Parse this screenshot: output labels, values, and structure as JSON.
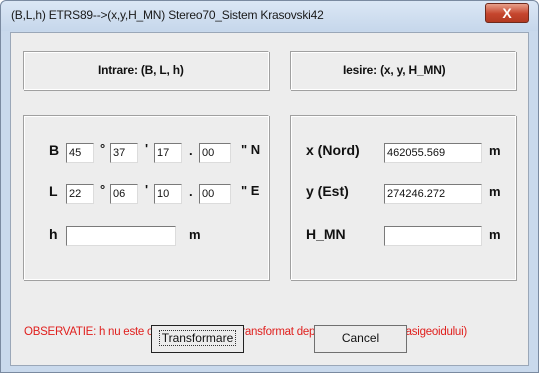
{
  "window": {
    "title": "(B,L,h) ETRS89-->(x,y,H_MN) Stereo70_Sistem Krasovski42",
    "close_glyph": "X"
  },
  "input_panel": {
    "title": "Intrare: (B, L, h)",
    "B": {
      "label": "B",
      "deg": "45",
      "min": "37",
      "sec": "17",
      "frac": "00",
      "hemisphere": "\" N"
    },
    "L": {
      "label": "L",
      "deg": "22",
      "min": "06",
      "sec": "10",
      "frac": "00",
      "hemisphere": "\" E"
    },
    "h": {
      "label": "h",
      "value": "",
      "unit": "m"
    },
    "deg_symbol": "°",
    "min_symbol": "'",
    "dot_symbol": "."
  },
  "output_panel": {
    "title": "Iesire: (x, y, H_MN)",
    "x": {
      "label": "x (Nord)",
      "value": "462055.569",
      "unit": "m"
    },
    "y": {
      "label": "y (Est)",
      "value": "274246.272",
      "unit": "m"
    },
    "H": {
      "label": "H_MN",
      "value": "",
      "unit": "m"
    }
  },
  "note": "OBSERVATIE: h nu este obligatoriu (H_MN transformat depinde de precizia cvasigeoidului)",
  "buttons": {
    "transform": "Transformare",
    "cancel": "Cancel"
  }
}
